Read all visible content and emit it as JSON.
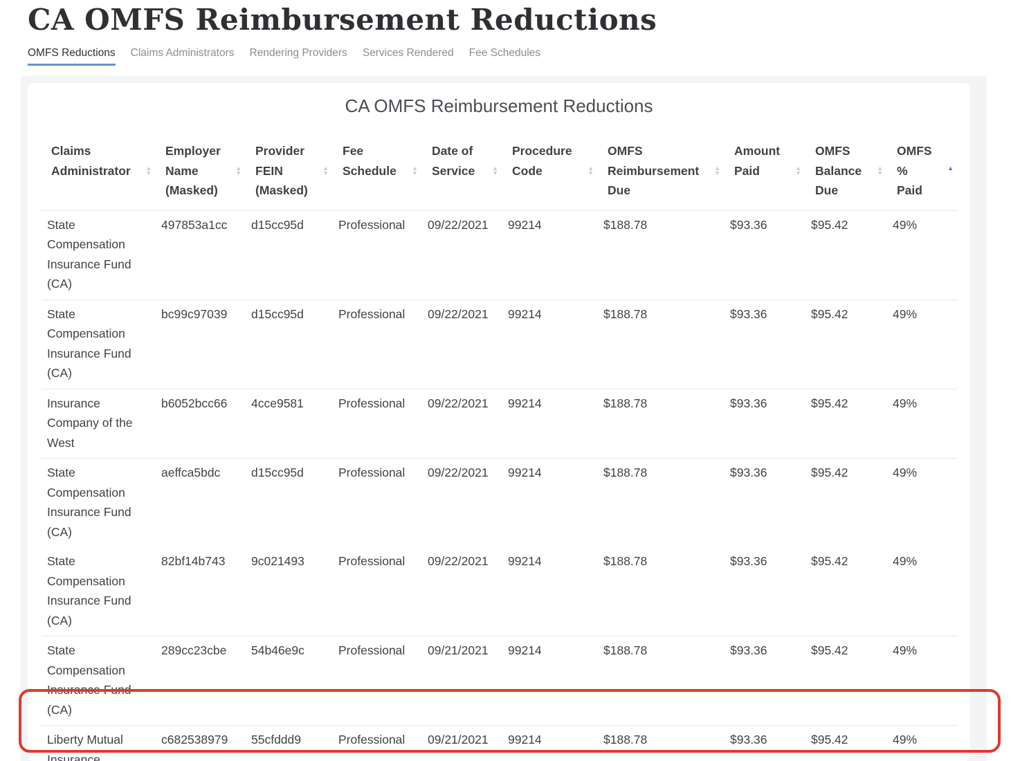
{
  "page": {
    "title": "CA OMFS Reimbursement Reductions"
  },
  "tabs": [
    {
      "label": "OMFS Reductions",
      "active": true
    },
    {
      "label": "Claims Administrators",
      "active": false
    },
    {
      "label": "Rendering Providers",
      "active": false
    },
    {
      "label": "Services Rendered",
      "active": false
    },
    {
      "label": "Fee Schedules",
      "active": false
    }
  ],
  "table": {
    "title": "CA OMFS Reimbursement Reductions",
    "columns": [
      {
        "label": "Claims Administrator"
      },
      {
        "label": "Employer Name (Masked)"
      },
      {
        "label": "Provider FEIN (Masked)"
      },
      {
        "label": "Fee Schedule"
      },
      {
        "label": "Date of Service"
      },
      {
        "label": "Procedure Code"
      },
      {
        "label": "OMFS Reimbursement Due"
      },
      {
        "label": "Amount Paid"
      },
      {
        "label": "OMFS Balance Due"
      },
      {
        "label": "OMFS % Paid",
        "sorted": "asc"
      }
    ],
    "rows": [
      [
        "State Compensation Insurance Fund (CA)",
        "497853a1cc",
        "d15cc95d",
        "Professional",
        "09/22/2021",
        "99214",
        "$188.78",
        "$93.36",
        "$95.42",
        "49%"
      ],
      [
        "State Compensation Insurance Fund (CA)",
        "bc99c97039",
        "d15cc95d",
        "Professional",
        "09/22/2021",
        "99214",
        "$188.78",
        "$93.36",
        "$95.42",
        "49%"
      ],
      [
        "Insurance Company of the West",
        "b6052bcc66",
        "4cce9581",
        "Professional",
        "09/22/2021",
        "99214",
        "$188.78",
        "$93.36",
        "$95.42",
        "49%"
      ],
      [
        "State Compensation Insurance Fund (CA)",
        "aeffca5bdc",
        "d15cc95d",
        "Professional",
        "09/22/2021",
        "99214",
        "$188.78",
        "$93.36",
        "$95.42",
        "49%"
      ],
      [
        "State Compensation Insurance Fund (CA)",
        "82bf14b743",
        "9c021493",
        "Professional",
        "09/22/2021",
        "99214",
        "$188.78",
        "$93.36",
        "$95.42",
        "49%"
      ],
      [
        "State Compensation Insurance Fund (CA)",
        "289cc23cbe",
        "54b46e9c",
        "Professional",
        "09/21/2021",
        "99214",
        "$188.78",
        "$93.36",
        "$95.42",
        "49%"
      ],
      [
        "Liberty Mutual Insurance",
        "c682538979",
        "55cfddd9",
        "Professional",
        "09/21/2021",
        "99214",
        "$188.78",
        "$93.36",
        "$95.42",
        "49%"
      ]
    ]
  },
  "colors": {
    "accent": "#6b8fd6",
    "highlight": "#e0392b",
    "sort_active": "#5a6fd1"
  }
}
